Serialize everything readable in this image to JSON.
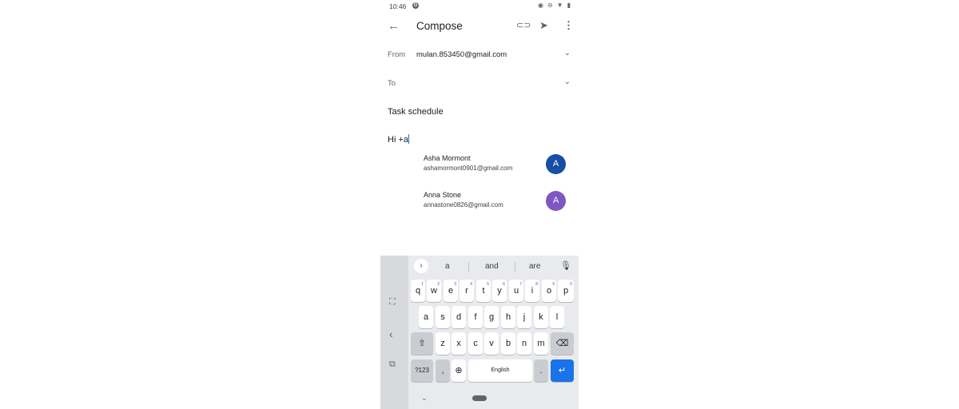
{
  "status": {
    "time": "10:46",
    "app_badge": "G",
    "icons": [
      "eye-icon",
      "dnd-icon",
      "wifi-icon",
      "battery-icon"
    ]
  },
  "toolbar": {
    "title": "Compose",
    "back_icon": "←",
    "attach_icon": "⊂⊃",
    "send_icon": "➤",
    "more_icon": "⋮"
  },
  "from": {
    "label": "From",
    "value": "mulan.853450@gmail.com"
  },
  "to": {
    "label": "To",
    "value": ""
  },
  "subject": "Task schedule",
  "body": "Hi +a",
  "suggestions": [
    {
      "name": "Asha Mormont",
      "email": "ashamormont0901@gmail.com",
      "initial": "A",
      "color": "#174ea6"
    },
    {
      "name": "Anna Stone",
      "email": "annastone0826@gmail.com",
      "initial": "A",
      "color": "#7e57c2"
    }
  ],
  "keyboard": {
    "suggest_words": [
      "a",
      "and",
      "are"
    ],
    "row1": [
      "q",
      "w",
      "e",
      "r",
      "t",
      "y",
      "u",
      "i",
      "o",
      "p"
    ],
    "row1_hints": [
      "1",
      "2",
      "3",
      "4",
      "5",
      "6",
      "7",
      "8",
      "9",
      "0"
    ],
    "row2": [
      "a",
      "s",
      "d",
      "f",
      "g",
      "h",
      "j",
      "k",
      "l"
    ],
    "row3": [
      "z",
      "x",
      "c",
      "v",
      "b",
      "n",
      "m"
    ],
    "symbols_key": "?123",
    "comma_key": ",",
    "space_label": "English",
    "period_key": "."
  },
  "colors": {
    "accent": "#1a73e8",
    "keyboard_bg": "#e8eaed"
  }
}
